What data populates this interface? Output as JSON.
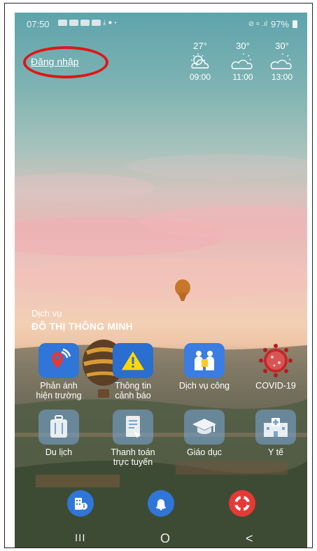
{
  "status_bar": {
    "time": "07:50",
    "signal_text": "⊘ ≈ .ıl",
    "battery": "97%"
  },
  "header": {
    "login_label": "Đăng nhập"
  },
  "weather": [
    {
      "temp": "27°",
      "time": "09:00",
      "icon": "partly-sunny-icon"
    },
    {
      "temp": "30°",
      "time": "11:00",
      "icon": "partly-cloudy-icon"
    },
    {
      "temp": "30°",
      "time": "13:00",
      "icon": "partly-cloudy-icon"
    }
  ],
  "services": {
    "heading_small": "Dịch vụ",
    "heading_large": "ĐÔ THỊ THÔNG MINH",
    "items": [
      {
        "label_1": "Phản ánh",
        "label_2": "hiện trường",
        "icon": "location-signal-icon"
      },
      {
        "label_1": "Thông tin",
        "label_2": "cảnh báo",
        "icon": "warning-icon"
      },
      {
        "label_1": "Dịch vụ công",
        "label_2": "",
        "icon": "people-document-icon"
      },
      {
        "label_1": "COVID-19",
        "label_2": "",
        "icon": "virus-icon"
      },
      {
        "label_1": "Du lịch",
        "label_2": "",
        "icon": "luggage-icon"
      },
      {
        "label_1": "Thanh toán",
        "label_2": "trực tuyến",
        "icon": "payment-document-icon"
      },
      {
        "label_1": "Giáo dục",
        "label_2": "",
        "icon": "graduation-cap-icon"
      },
      {
        "label_1": "Y tế",
        "label_2": "",
        "icon": "hospital-icon"
      }
    ]
  },
  "bottom_actions": [
    "building-info-icon",
    "bell-icon",
    "lifebuoy-icon"
  ],
  "nav": {
    "recent": "III",
    "home": "O",
    "back": "<"
  },
  "colors": {
    "accent_blue": "#2f76d8",
    "red": "#e01616",
    "highlight_oval": "#e01616"
  }
}
